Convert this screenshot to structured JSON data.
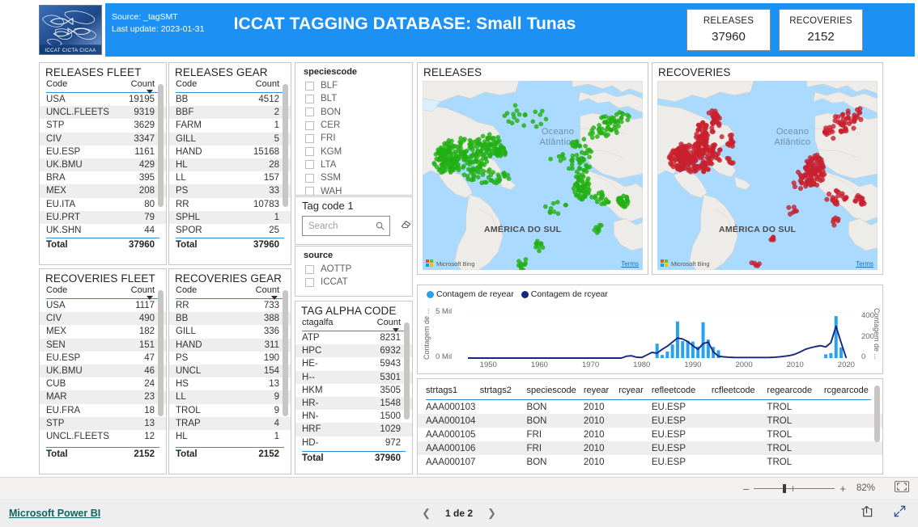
{
  "header": {
    "source_line": "Source: _tagSMT",
    "update_line": "Last update: 2023-01-31",
    "title": "ICCAT TAGGING DATABASE: Small Tunas",
    "logo_caption": "ICCAT  CICTA  CICAA",
    "banner_color": "#1c90f3",
    "kpis": [
      {
        "label": "RELEASES",
        "value": "37960"
      },
      {
        "label": "RECOVERIES",
        "value": "2152"
      }
    ]
  },
  "releases_fleet": {
    "title": "RELEASES FLEET",
    "col_code": "Code",
    "col_count": "Count",
    "rows": [
      {
        "code": "USA",
        "count": "19195"
      },
      {
        "code": "UNCL.FLEETS",
        "count": "9319"
      },
      {
        "code": "STP",
        "count": "3629"
      },
      {
        "code": "CIV",
        "count": "3347"
      },
      {
        "code": "EU.ESP",
        "count": "1161"
      },
      {
        "code": "UK.BMU",
        "count": "429"
      },
      {
        "code": "BRA",
        "count": "395"
      },
      {
        "code": "MEX",
        "count": "208"
      },
      {
        "code": "EU.ITA",
        "count": "80"
      },
      {
        "code": "EU.PRT",
        "count": "79"
      },
      {
        "code": "UK.SHN",
        "count": "44"
      }
    ],
    "total_label": "Total",
    "total_value": "37960"
  },
  "releases_gear": {
    "title": "RELEASES GEAR",
    "col_code": "Code",
    "col_count": "Count",
    "rows": [
      {
        "code": "BB",
        "count": "4512"
      },
      {
        "code": "BBF",
        "count": "2"
      },
      {
        "code": "FARM",
        "count": "1"
      },
      {
        "code": "GILL",
        "count": "5"
      },
      {
        "code": "HAND",
        "count": "15168"
      },
      {
        "code": "HL",
        "count": "28"
      },
      {
        "code": "LL",
        "count": "157"
      },
      {
        "code": "PS",
        "count": "33"
      },
      {
        "code": "RR",
        "count": "10783"
      },
      {
        "code": "SPHL",
        "count": "1"
      },
      {
        "code": "SPOR",
        "count": "25"
      }
    ],
    "total_label": "Total",
    "total_value": "37960"
  },
  "recoveries_fleet": {
    "title": "RECOVERIES FLEET",
    "col_code": "Code",
    "col_count": "Count",
    "rows": [
      {
        "code": "USA",
        "count": "1117"
      },
      {
        "code": "CIV",
        "count": "490"
      },
      {
        "code": "MEX",
        "count": "182"
      },
      {
        "code": "SEN",
        "count": "151"
      },
      {
        "code": "EU.ESP",
        "count": "47"
      },
      {
        "code": "UK.BMU",
        "count": "46"
      },
      {
        "code": "CUB",
        "count": "24"
      },
      {
        "code": "MAR",
        "count": "23"
      },
      {
        "code": "EU.FRA",
        "count": "18"
      },
      {
        "code": "STP",
        "count": "13"
      },
      {
        "code": "UNCL.FLEETS",
        "count": "12"
      }
    ],
    "total_label": "Total",
    "total_value": "2152"
  },
  "recoveries_gear": {
    "title": "RECOVERIES GEAR",
    "col_code": "Code",
    "col_count": "Count",
    "rows": [
      {
        "code": "RR",
        "count": "733"
      },
      {
        "code": "BB",
        "count": "388"
      },
      {
        "code": "GILL",
        "count": "336"
      },
      {
        "code": "HAND",
        "count": "311"
      },
      {
        "code": "PS",
        "count": "190"
      },
      {
        "code": "UNCL",
        "count": "154"
      },
      {
        "code": "HS",
        "count": "13"
      },
      {
        "code": "LL",
        "count": "9"
      },
      {
        "code": "TROL",
        "count": "9"
      },
      {
        "code": "TRAP",
        "count": "4"
      },
      {
        "code": "HL",
        "count": "1"
      }
    ],
    "total_label": "Total",
    "total_value": "2152"
  },
  "species_slicer": {
    "title": "speciescode",
    "items": [
      "BLF",
      "BLT",
      "BON",
      "CER",
      "FRI",
      "KGM",
      "LTA",
      "SSM",
      "WAH"
    ]
  },
  "tag_code_slicer": {
    "title": "Tag code 1",
    "search_placeholder": "Search",
    "search_value": ""
  },
  "source_slicer": {
    "title": "source",
    "items": [
      "AOTTP",
      "ICCAT"
    ]
  },
  "tag_alpha_code": {
    "title": "TAG ALPHA CODE",
    "col_code": "ctagalfa",
    "col_count": "Count",
    "rows": [
      {
        "code": "ATP",
        "count": "8231"
      },
      {
        "code": "HPC",
        "count": "6932"
      },
      {
        "code": "HE-",
        "count": "5943"
      },
      {
        "code": "H--",
        "count": "5301"
      },
      {
        "code": "HKM",
        "count": "3505"
      },
      {
        "code": "HR-",
        "count": "1548"
      },
      {
        "code": "HN-",
        "count": "1500"
      },
      {
        "code": "HRF",
        "count": "1029"
      },
      {
        "code": "HD-",
        "count": "972"
      }
    ],
    "total_label": "Total",
    "total_value": "37960"
  },
  "map_releases": {
    "title": "RELEASES",
    "ocean_label_l1": "Oceano",
    "ocean_label_l2": "Atlântico",
    "continent_label": "AMÉRICA DO SUL",
    "attribution": "Microsoft Bing",
    "terms": "Terms",
    "point_color": "#22b014"
  },
  "map_recoveries": {
    "title": "RECOVERIES",
    "ocean_label_l1": "Oceano",
    "ocean_label_l2": "Atlântico",
    "continent_label": "AMÉRICA DO SUL",
    "attribution": "Microsoft Bing",
    "terms": "Terms",
    "point_color": "#c8202e"
  },
  "chart_data": {
    "type": "bar",
    "title": "",
    "legend": [
      {
        "label": "Contagem de reyear",
        "color": "#2aa1ef"
      },
      {
        "label": "Contagem de rcyear",
        "color": "#15297c"
      }
    ],
    "legend_position": "top-left",
    "grid": true,
    "xlabel": "",
    "x_ticks": [
      "1950",
      "1960",
      "1970",
      "1980",
      "1990",
      "2000",
      "2010",
      "2020"
    ],
    "xlim": [
      1946,
      2022
    ],
    "ylabel": "Contagem de ...",
    "y_ticks": [
      "0 Mil",
      "5 Mil"
    ],
    "ylim": [
      0,
      5500
    ],
    "y2label": "Contagem de ...",
    "y2_ticks": [
      "0",
      "200",
      "400"
    ],
    "y2lim": [
      0,
      440
    ],
    "x": [
      1946,
      1947,
      1948,
      1949,
      1950,
      1951,
      1952,
      1953,
      1954,
      1955,
      1956,
      1957,
      1958,
      1959,
      1960,
      1961,
      1962,
      1963,
      1964,
      1965,
      1966,
      1967,
      1968,
      1969,
      1970,
      1971,
      1972,
      1973,
      1974,
      1975,
      1976,
      1977,
      1978,
      1979,
      1980,
      1981,
      1982,
      1983,
      1984,
      1985,
      1986,
      1987,
      1988,
      1989,
      1990,
      1991,
      1992,
      1993,
      1994,
      1995,
      1996,
      1997,
      1998,
      1999,
      2000,
      2001,
      2002,
      2003,
      2004,
      2005,
      2006,
      2007,
      2008,
      2009,
      2010,
      2011,
      2012,
      2013,
      2014,
      2015,
      2016,
      2017,
      2018,
      2019,
      2020
    ],
    "series": [
      {
        "name": "Contagem de reyear",
        "type": "bar",
        "axis": "left",
        "color": "#2aa1ef",
        "values": [
          0,
          0,
          0,
          0,
          0,
          0,
          0,
          0,
          0,
          0,
          0,
          0,
          0,
          0,
          0,
          0,
          0,
          0,
          0,
          0,
          0,
          0,
          0,
          0,
          0,
          0,
          0,
          0,
          0,
          0,
          0,
          0,
          0,
          0,
          0,
          0,
          0,
          1750,
          380,
          800,
          1650,
          4450,
          2050,
          2100,
          2000,
          1400,
          4350,
          2250,
          1350,
          950,
          0,
          0,
          0,
          0,
          0,
          0,
          0,
          0,
          0,
          0,
          0,
          0,
          0,
          0,
          0,
          0,
          0,
          0,
          0,
          0,
          450,
          600,
          5100,
          1300,
          0
        ]
      },
      {
        "name": "Contagem de rcyear",
        "type": "line",
        "axis": "right",
        "color": "#15297c",
        "values": [
          0,
          0,
          0,
          0,
          0,
          0,
          0,
          0,
          0,
          0,
          0,
          0,
          0,
          0,
          0,
          0,
          0,
          0,
          0,
          0,
          0,
          0,
          0,
          0,
          0,
          0,
          0,
          0,
          0,
          0,
          0,
          18,
          22,
          8,
          6,
          30,
          55,
          48,
          85,
          115,
          155,
          195,
          185,
          160,
          120,
          85,
          140,
          155,
          60,
          18,
          12,
          8,
          6,
          5,
          5,
          5,
          5,
          5,
          5,
          6,
          8,
          12,
          18,
          25,
          38,
          60,
          85,
          100,
          112,
          120,
          108,
          150,
          310,
          150,
          0
        ]
      }
    ]
  },
  "data_grid": {
    "columns": [
      "strtags1",
      "strtags2",
      "speciescode",
      "reyear",
      "rcyear",
      "refleetcode",
      "rcfleetcode",
      "regearcode",
      "rcgearcode"
    ],
    "rows": [
      [
        "AAA000103",
        "",
        "BON",
        "2010",
        "",
        "EU.ESP",
        "",
        "TROL",
        ""
      ],
      [
        "AAA000104",
        "",
        "BON",
        "2010",
        "",
        "EU.ESP",
        "",
        "TROL",
        ""
      ],
      [
        "AAA000105",
        "",
        "FRI",
        "2010",
        "",
        "EU.ESP",
        "",
        "TROL",
        ""
      ],
      [
        "AAA000106",
        "",
        "FRI",
        "2010",
        "",
        "EU.ESP",
        "",
        "TROL",
        ""
      ],
      [
        "AAA000107",
        "",
        "BON",
        "2010",
        "",
        "EU.ESP",
        "",
        "TROL",
        ""
      ]
    ]
  },
  "chrome": {
    "zoom_minus": "–",
    "zoom_plus": "+",
    "zoom_percent": "82%",
    "fit_to_page_icon": "fit-to-page-icon",
    "pbi_link": "Microsoft Power BI",
    "page_indicator": "1 de 2",
    "prev_icon": "chevron-left-icon",
    "next_icon": "chevron-right-icon",
    "share_icon": "share-icon",
    "fullscreen_icon": "fullscreen-icon"
  }
}
